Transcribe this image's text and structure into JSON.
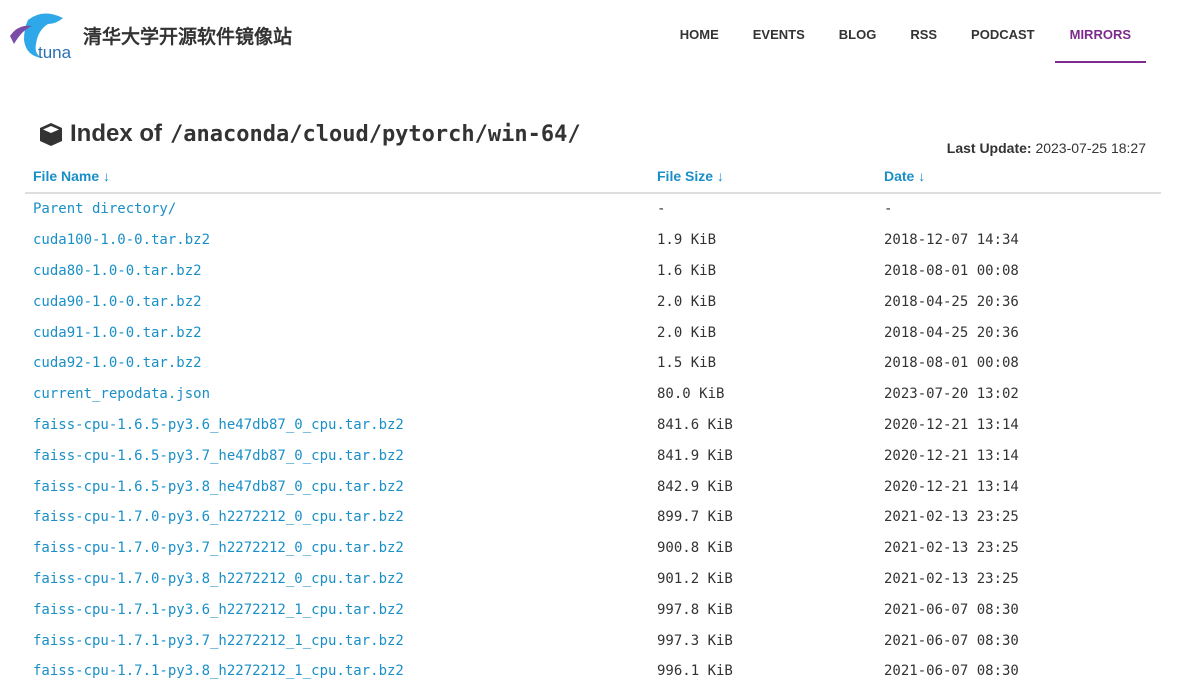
{
  "site": {
    "title": "清华大学开源软件镜像站",
    "logo_text": "tuna"
  },
  "nav": [
    {
      "label": "HOME"
    },
    {
      "label": "EVENTS"
    },
    {
      "label": "BLOG"
    },
    {
      "label": "RSS"
    },
    {
      "label": "PODCAST"
    },
    {
      "label": "MIRRORS",
      "active": true
    }
  ],
  "page": {
    "title_prefix": "Index of",
    "path": "/anaconda/cloud/pytorch/win-64/",
    "last_update_label": "Last Update:",
    "last_update": "2023-07-25 18:27"
  },
  "colors": {
    "accent": "#7b2c8c",
    "link": "#1a8fc7"
  },
  "table": {
    "headers": [
      "File Name ↓",
      "File Size ↓",
      "Date ↓"
    ],
    "rows": [
      [
        "Parent directory/",
        "-",
        "-"
      ],
      [
        "cuda100-1.0-0.tar.bz2",
        "1.9 KiB",
        "2018-12-07 14:34"
      ],
      [
        "cuda80-1.0-0.tar.bz2",
        "1.6 KiB",
        "2018-08-01 00:08"
      ],
      [
        "cuda90-1.0-0.tar.bz2",
        "2.0 KiB",
        "2018-04-25 20:36"
      ],
      [
        "cuda91-1.0-0.tar.bz2",
        "2.0 KiB",
        "2018-04-25 20:36"
      ],
      [
        "cuda92-1.0-0.tar.bz2",
        "1.5 KiB",
        "2018-08-01 00:08"
      ],
      [
        "current_repodata.json",
        "80.0 KiB",
        "2023-07-20 13:02"
      ],
      [
        "faiss-cpu-1.6.5-py3.6_he47db87_0_cpu.tar.bz2",
        "841.6 KiB",
        "2020-12-21 13:14"
      ],
      [
        "faiss-cpu-1.6.5-py3.7_he47db87_0_cpu.tar.bz2",
        "841.9 KiB",
        "2020-12-21 13:14"
      ],
      [
        "faiss-cpu-1.6.5-py3.8_he47db87_0_cpu.tar.bz2",
        "842.9 KiB",
        "2020-12-21 13:14"
      ],
      [
        "faiss-cpu-1.7.0-py3.6_h2272212_0_cpu.tar.bz2",
        "899.7 KiB",
        "2021-02-13 23:25"
      ],
      [
        "faiss-cpu-1.7.0-py3.7_h2272212_0_cpu.tar.bz2",
        "900.8 KiB",
        "2021-02-13 23:25"
      ],
      [
        "faiss-cpu-1.7.0-py3.8_h2272212_0_cpu.tar.bz2",
        "901.2 KiB",
        "2021-02-13 23:25"
      ],
      [
        "faiss-cpu-1.7.1-py3.6_h2272212_1_cpu.tar.bz2",
        "997.8 KiB",
        "2021-06-07 08:30"
      ],
      [
        "faiss-cpu-1.7.1-py3.7_h2272212_1_cpu.tar.bz2",
        "997.3 KiB",
        "2021-06-07 08:30"
      ],
      [
        "faiss-cpu-1.7.1-py3.8_h2272212_1_cpu.tar.bz2",
        "996.1 KiB",
        "2021-06-07 08:30"
      ]
    ]
  }
}
